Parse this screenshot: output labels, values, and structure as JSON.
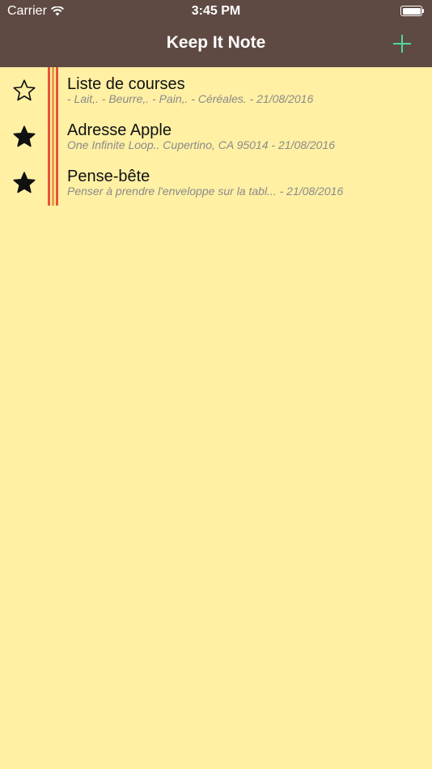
{
  "status_bar": {
    "carrier": "Carrier",
    "time": "3:45 PM",
    "battery_level": 1.0
  },
  "nav": {
    "title": "Keep It Note",
    "add_icon": "plus-icon"
  },
  "colors": {
    "nav_background": "#5F4A43",
    "page_background": "#FFF0A4",
    "add_icon": "#4CD9A0",
    "margin_red": "#E8523A",
    "margin_orange": "#E8A03A"
  },
  "notes": [
    {
      "title": "Liste de courses",
      "subtitle": "- Lait,. - Beurre,. - Pain,. - Céréales. - 21/08/2016",
      "favorite": false
    },
    {
      "title": "Adresse Apple",
      "subtitle": "One Infinite Loop.. Cupertino, CA 95014 - 21/08/2016",
      "favorite": true
    },
    {
      "title": "Pense-bête",
      "subtitle": "Penser à prendre l'enveloppe sur la tabl... - 21/08/2016",
      "favorite": true
    }
  ]
}
